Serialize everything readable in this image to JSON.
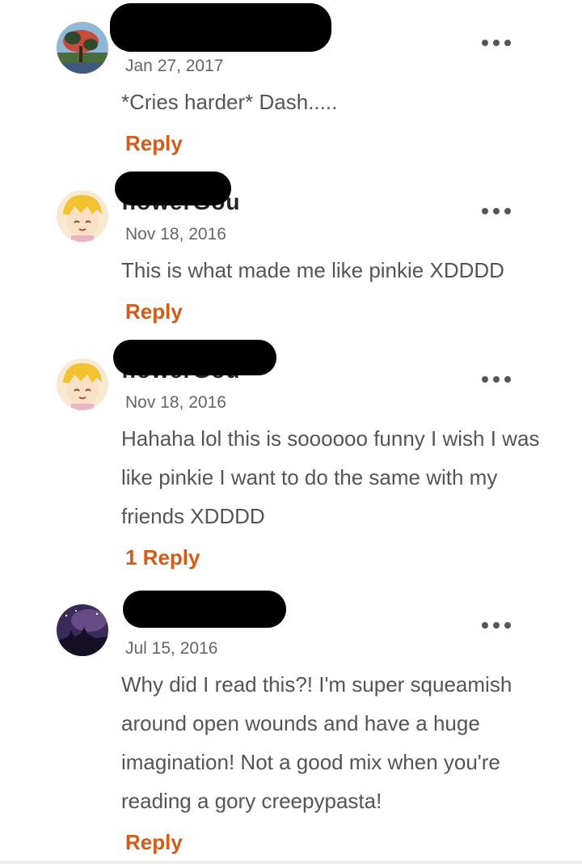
{
  "comments": [
    {
      "username": "",
      "date": "Jan 27, 2017",
      "body": "*Cries harder* Dash.....",
      "reply": "Reply",
      "avatar": "tree-landscape"
    },
    {
      "username": "flowerGou",
      "date": "Nov 18, 2016",
      "body": "This is what made me like pinkie XDDDD",
      "reply": "Reply",
      "avatar": "anime-blonde-girl"
    },
    {
      "username": "flowerGou",
      "date": "Nov 18, 2016",
      "body": "Hahaha lol this is soooooo funny I wish I was like pinkie I want to do the same with my friends XDDDD",
      "reply": "1 Reply",
      "avatar": "anime-blonde-girl"
    },
    {
      "username": "",
      "date": "Jul 15, 2016",
      "body": "Why did I read this?! I'm super squeamish around open wounds and have a huge imagination! Not a good mix when you're reading a gory creepypasta!",
      "reply": "Reply",
      "avatar": "night-sky-castle"
    }
  ],
  "colors": {
    "reply": "#d85a14",
    "redaction": "#000000"
  }
}
